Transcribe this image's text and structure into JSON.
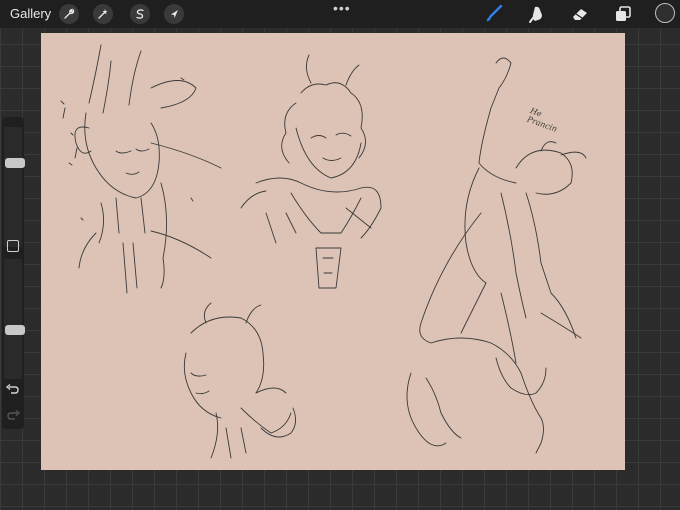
{
  "toolbar": {
    "gallery_label": "Gallery",
    "left_tools": [
      "wrench-icon",
      "magic-wand-icon",
      "selection-icon",
      "transform-arrow-icon"
    ],
    "more_indicator": "•••",
    "right_tools": [
      "brush-icon",
      "smudge-icon",
      "eraser-icon",
      "layers-icon"
    ],
    "active_tool": "brush",
    "accent_color": "#2f80ed",
    "current_color": "#2f2f2f"
  },
  "sidebar": {
    "brush_size_level": 0.72,
    "opacity_level": 0.4,
    "undo_icon": "undo-icon",
    "redo_icon": "redo-icon"
  },
  "canvas": {
    "background_color": "#dcc3b5",
    "stroke_color": "#3a3a3a",
    "annotation_line1": "He",
    "annotation_line2": "Prancin"
  }
}
